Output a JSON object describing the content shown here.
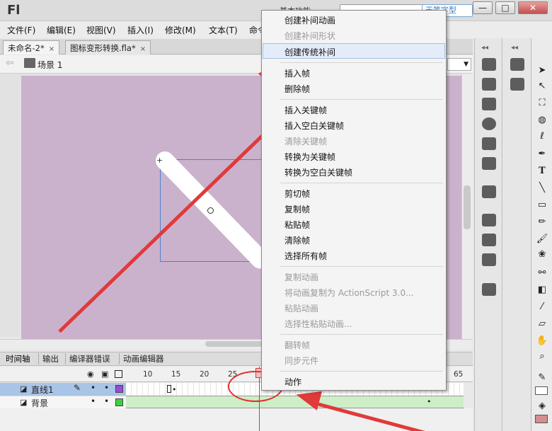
{
  "app": {
    "logo": "Fl",
    "workspace": "基本功能",
    "watermark": "无笔字型"
  },
  "window_controls": {
    "minimize": "—",
    "maximize": "□",
    "close": "✕"
  },
  "menus": [
    "文件(F)",
    "编辑(E)",
    "视图(V)",
    "插入(I)",
    "修改(M)",
    "文本(T)",
    "命令"
  ],
  "tabs": [
    {
      "label": "未命名-2*",
      "close": "×"
    },
    {
      "label": "图标变形转换.fla*",
      "close": "×"
    }
  ],
  "editbar": {
    "scene": "场景 1"
  },
  "timeline": {
    "tabs": [
      "时间轴",
      "输出",
      "编译器错误",
      "动画编辑器"
    ],
    "frame_numbers": [
      "10",
      "15",
      "20",
      "25",
      "3",
      "65"
    ],
    "layers": [
      {
        "name": "直线1",
        "selected": true,
        "color": "#9a4ad4"
      },
      {
        "name": "背景",
        "selected": false,
        "color": "#3fcf3f"
      }
    ]
  },
  "context_menu": {
    "items": [
      {
        "label": "创建补间动画",
        "enabled": true
      },
      {
        "label": "创建补间形状",
        "enabled": false
      },
      {
        "label": "创建传统补间",
        "enabled": true,
        "highlighted": true
      },
      {
        "label": "插入帧",
        "enabled": true
      },
      {
        "label": "删除帧",
        "enabled": true
      },
      {
        "label": "插入关键帧",
        "enabled": true
      },
      {
        "label": "插入空白关键帧",
        "enabled": true
      },
      {
        "label": "清除关键帧",
        "enabled": false
      },
      {
        "label": "转换为关键帧",
        "enabled": true
      },
      {
        "label": "转换为空白关键帧",
        "enabled": true
      },
      {
        "label": "剪切帧",
        "enabled": true
      },
      {
        "label": "复制帧",
        "enabled": true
      },
      {
        "label": "粘贴帧",
        "enabled": true
      },
      {
        "label": "清除帧",
        "enabled": true
      },
      {
        "label": "选择所有帧",
        "enabled": true
      },
      {
        "label": "复制动画",
        "enabled": false
      },
      {
        "label": "将动画复制为 ActionScript 3.0...",
        "enabled": false
      },
      {
        "label": "粘贴动画",
        "enabled": false
      },
      {
        "label": "选择性粘贴动画...",
        "enabled": false
      },
      {
        "label": "翻转帧",
        "enabled": false
      },
      {
        "label": "同步元件",
        "enabled": false
      },
      {
        "label": "动作",
        "enabled": true
      }
    ]
  },
  "colors": {
    "stage": "#cbb2cc",
    "annotation": "#e03030",
    "selection": "#4a7fd0"
  }
}
